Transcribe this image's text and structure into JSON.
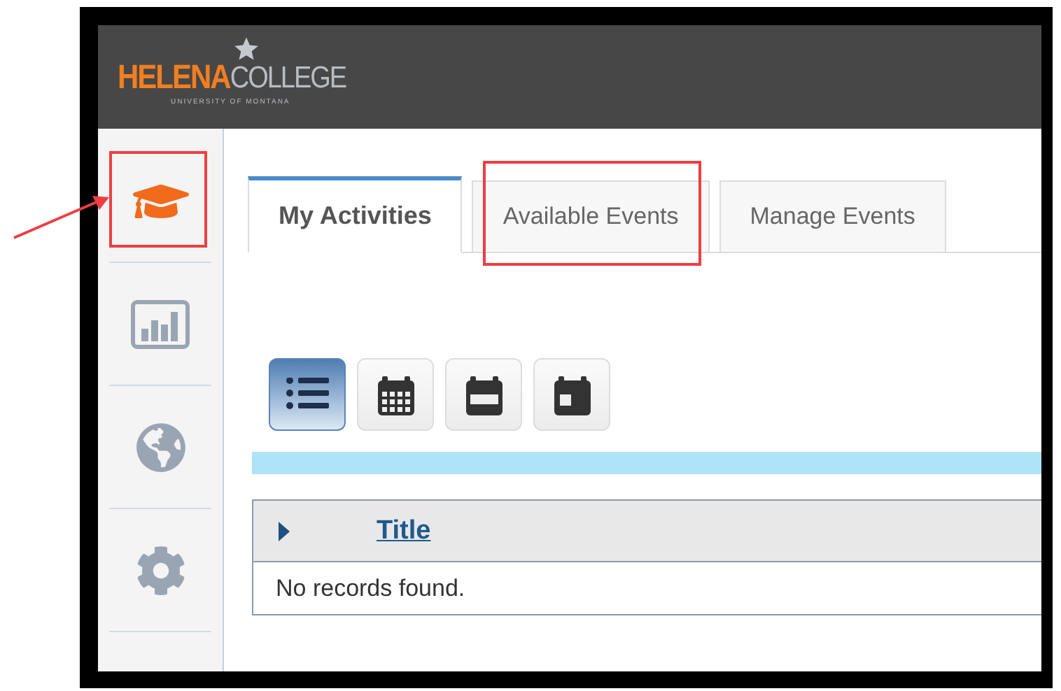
{
  "header": {
    "logo": {
      "primary": "HELENA",
      "secondary": "COLLEGE",
      "subtitle": "UNIVERSITY OF MONTANA"
    }
  },
  "sidebar": {
    "items": [
      {
        "kind": "cap",
        "selected": true,
        "highlighted": true
      },
      {
        "kind": "chart",
        "selected": false,
        "highlighted": false
      },
      {
        "kind": "globe",
        "selected": false,
        "highlighted": false
      },
      {
        "kind": "gear",
        "selected": false,
        "highlighted": false
      }
    ]
  },
  "tabs": [
    {
      "label": "My Activities",
      "selected": true,
      "highlighted": false
    },
    {
      "label": "Available Events",
      "selected": false,
      "highlighted": true
    },
    {
      "label": "Manage Events",
      "selected": false,
      "highlighted": false
    }
  ],
  "view_buttons": [
    {
      "kind": "list",
      "selected": true
    },
    {
      "kind": "month",
      "selected": false
    },
    {
      "kind": "week",
      "selected": false
    },
    {
      "kind": "day",
      "selected": false
    }
  ],
  "table": {
    "columns": [
      "Title"
    ],
    "empty_message": "No records found."
  }
}
